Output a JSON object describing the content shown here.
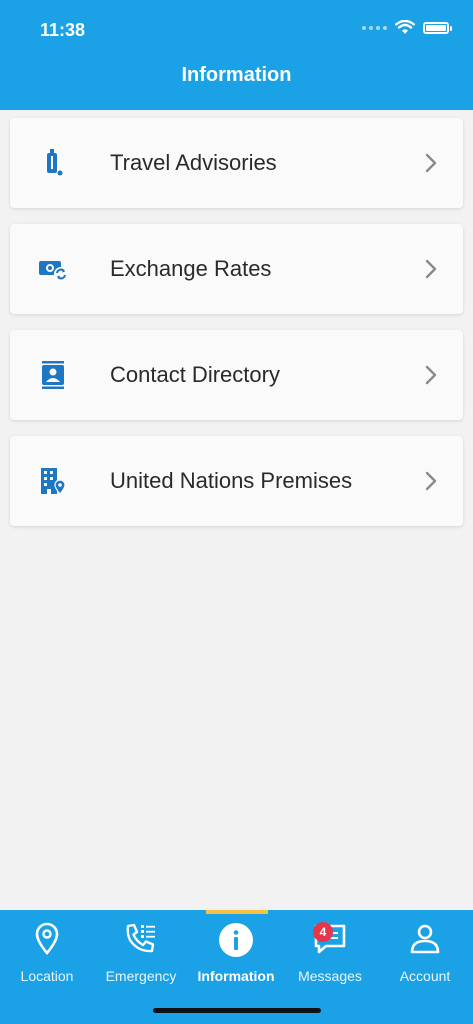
{
  "status_bar": {
    "time": "11:38"
  },
  "header": {
    "title": "Information"
  },
  "menu": [
    {
      "label": "Travel Advisories",
      "icon": "suitcase-icon"
    },
    {
      "label": "Exchange Rates",
      "icon": "currency-exchange-icon"
    },
    {
      "label": "Contact Directory",
      "icon": "contact-card-icon"
    },
    {
      "label": "United Nations Premises",
      "icon": "building-location-icon"
    }
  ],
  "tabbar": {
    "tabs": [
      {
        "label": "Location",
        "icon": "location-pin-icon"
      },
      {
        "label": "Emergency",
        "icon": "phone-list-icon"
      },
      {
        "label": "Information",
        "icon": "info-icon",
        "active": true
      },
      {
        "label": "Messages",
        "icon": "chat-icon",
        "badge": "4"
      },
      {
        "label": "Account",
        "icon": "person-icon"
      }
    ]
  },
  "colors": {
    "primary": "#1aa1e6",
    "active_indicator": "#f5c242",
    "badge": "#e6374a",
    "icon_blue": "#1f77c4"
  }
}
